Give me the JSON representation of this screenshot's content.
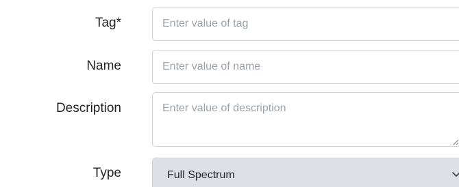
{
  "form": {
    "tag": {
      "label": "Tag*",
      "placeholder": "Enter value of tag",
      "value": ""
    },
    "name": {
      "label": "Name",
      "placeholder": "Enter value of name",
      "value": ""
    },
    "description": {
      "label": "Description",
      "placeholder": "Enter value of description",
      "value": ""
    },
    "type": {
      "label": "Type",
      "selected": "Full Spectrum",
      "icon": "chevron-down-icon"
    }
  },
  "colors": {
    "label_text": "#212529",
    "placeholder_text": "#9aa3ab",
    "field_border": "#ced4da",
    "select_background": "#dde1e5"
  }
}
